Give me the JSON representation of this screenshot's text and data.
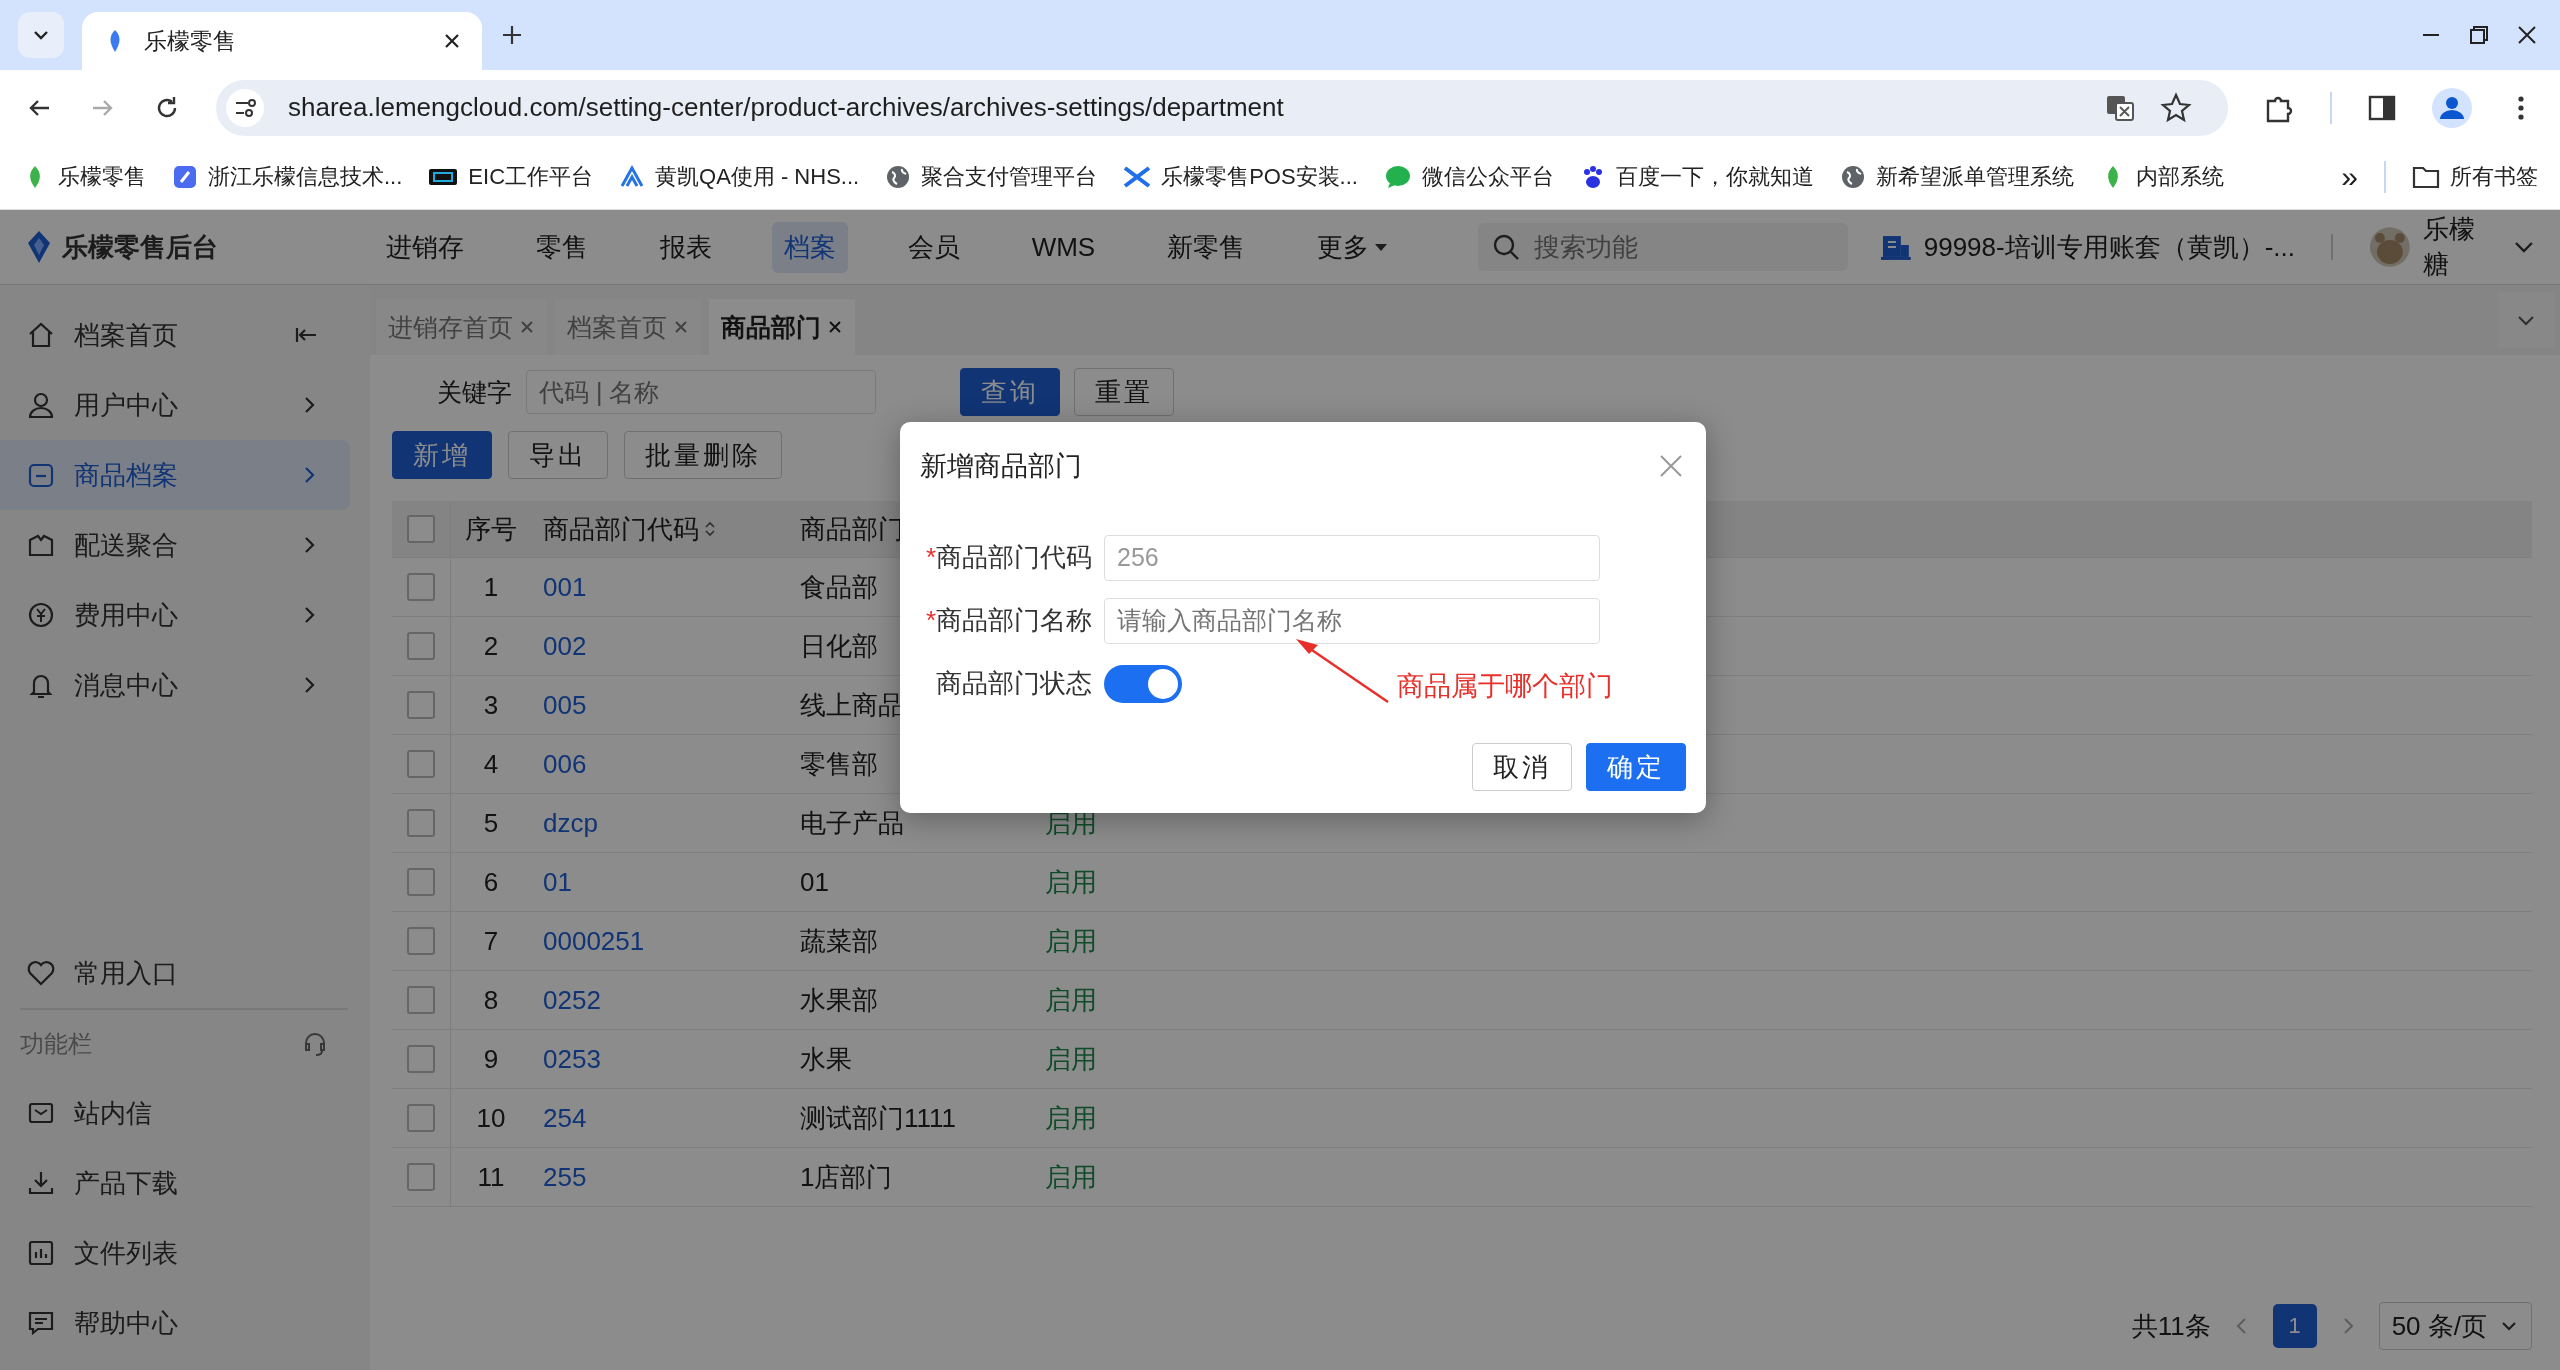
{
  "browser": {
    "tab_title": "乐檬零售",
    "url": "sharea.lemengcloud.com/setting-center/product-archives/archives-settings/department",
    "bookmarks": [
      "乐檬零售",
      "浙江乐檬信息技术...",
      "EIC工作平台",
      "黄凯QA使用 - NHS...",
      "聚合支付管理平台",
      "乐檬零售POS安装...",
      "微信公众平台",
      "百度一下，你就知道",
      "新希望派单管理系统",
      "内部系统"
    ],
    "more_bookmarks": "»",
    "all_bookmarks": "所有书签"
  },
  "app": {
    "logo": "乐檬零售后台",
    "nav": [
      {
        "label": "进销存",
        "selected": false
      },
      {
        "label": "零售",
        "selected": false
      },
      {
        "label": "报表",
        "selected": false
      },
      {
        "label": "档案",
        "selected": true
      },
      {
        "label": "会员",
        "selected": false
      },
      {
        "label": "WMS",
        "selected": false
      },
      {
        "label": "新零售",
        "selected": false
      },
      {
        "label": "更多",
        "selected": false
      }
    ],
    "search": {
      "placeholder": "搜索功能"
    },
    "account": "99998-培训专用账套（黄凯）-...",
    "user": "乐檬糖"
  },
  "sidebar": {
    "items": [
      {
        "label": "档案首页",
        "selected": false
      },
      {
        "label": "用户中心",
        "selected": false
      },
      {
        "label": "商品档案",
        "selected": true
      },
      {
        "label": "配送聚合",
        "selected": false
      },
      {
        "label": "费用中心",
        "selected": false
      },
      {
        "label": "消息中心",
        "selected": false
      }
    ],
    "favorites": "常用入口",
    "section_title": "功能栏",
    "tools": [
      "站内信",
      "产品下载",
      "文件列表",
      "帮助中心"
    ]
  },
  "page_tabs": [
    {
      "label": "进销存首页",
      "selected": false
    },
    {
      "label": "档案首页",
      "selected": false
    },
    {
      "label": "商品部门",
      "selected": true
    }
  ],
  "filter": {
    "label": "关键字",
    "placeholder": "代码 | 名称",
    "buttons": [
      "查询",
      "重置"
    ]
  },
  "actions": [
    {
      "label": "新增",
      "kind": "primary"
    },
    {
      "label": "导出",
      "kind": "default"
    },
    {
      "label": "批量删除",
      "kind": "default"
    }
  ],
  "table": {
    "select_all_checked": false,
    "columns": [
      "序号",
      "商品部门代码",
      "商品部门"
    ],
    "rows": [
      {
        "checked": false,
        "index": "1",
        "code": "001",
        "name": "食品部"
      },
      {
        "checked": false,
        "index": "2",
        "code": "002",
        "name": "日化部"
      },
      {
        "checked": false,
        "index": "3",
        "code": "005",
        "name": "线上商品"
      },
      {
        "checked": false,
        "index": "4",
        "code": "006",
        "name": "零售部"
      },
      {
        "checked": false,
        "index": "5",
        "code": "dzcp",
        "name": "电子产品",
        "status": "启用"
      },
      {
        "checked": false,
        "index": "6",
        "code": "01",
        "name": "01",
        "status": "启用"
      },
      {
        "checked": false,
        "index": "7",
        "code": "0000251",
        "name": "蔬菜部",
        "status": "启用"
      },
      {
        "checked": false,
        "index": "8",
        "code": "0252",
        "name": "水果部",
        "status": "启用"
      },
      {
        "checked": false,
        "index": "9",
        "code": "0253",
        "name": "水果",
        "status": "启用"
      },
      {
        "checked": false,
        "index": "10",
        "code": "254",
        "name": "测试部门1111",
        "status": "启用"
      },
      {
        "checked": false,
        "index": "11",
        "code": "255",
        "name": "1店部门",
        "status": "启用"
      }
    ]
  },
  "pagination": {
    "total": "共11条",
    "pages": [
      {
        "label": "1",
        "selected": true
      }
    ],
    "page_size": "50 条/页"
  },
  "dialog": {
    "title": "新增商品部门",
    "fields": [
      {
        "label": "商品部门代码",
        "required_mark": "*",
        "kind": "input",
        "value": "256"
      },
      {
        "label": "商品部门名称",
        "required_mark": "*",
        "kind": "input",
        "placeholder": "请输入商品部门名称"
      },
      {
        "label": "商品部门状态",
        "kind": "switch",
        "on": true
      }
    ],
    "annotation": "商品属于哪个部门",
    "buttons": [
      {
        "label": "取消",
        "kind": "default"
      },
      {
        "label": "确定",
        "kind": "primary"
      }
    ]
  }
}
